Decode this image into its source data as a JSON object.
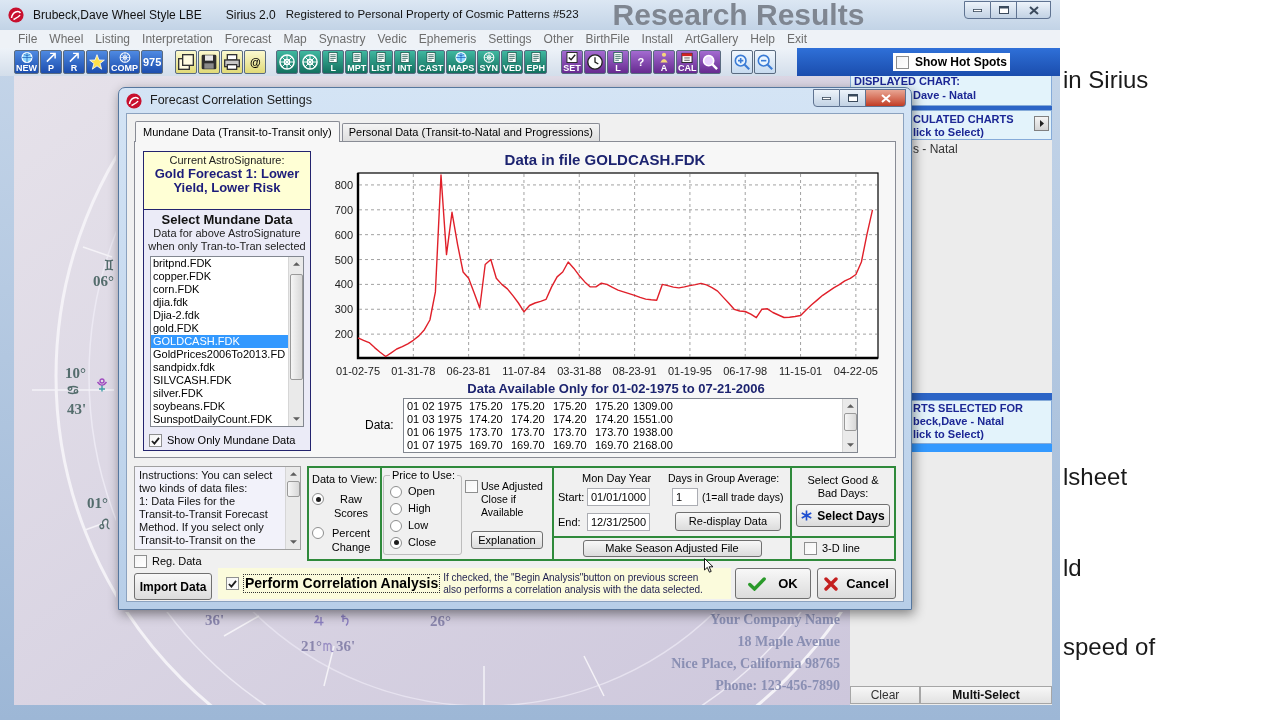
{
  "main_window": {
    "title": "Brubeck,Dave Wheel Style LBE",
    "app_name": "Sirius 2.0",
    "registration": "Registered to Personal Property of Cosmic Patterns #523",
    "backdrop_heading": "Research Results"
  },
  "menu": [
    "File",
    "Wheel",
    "Listing",
    "Interpretation",
    "Forecast",
    "Map",
    "Synastry",
    "Vedic",
    "Ephemeris",
    "Settings",
    "Other",
    "BirthFile",
    "Install",
    "ArtGallery",
    "Help",
    "Exit"
  ],
  "toolbar": [
    {
      "kind": "chart",
      "buttons": [
        {
          "kind": "globe",
          "label": "NEW"
        },
        {
          "kind": "arrow",
          "label": "P"
        },
        {
          "kind": "arrow",
          "label": "R"
        },
        {
          "kind": "star"
        },
        {
          "kind": "wheel",
          "label": "COMP"
        },
        {
          "label": "975"
        }
      ]
    },
    {
      "kind": "file",
      "buttons": [
        {
          "kind": "windows"
        },
        {
          "kind": "disk"
        },
        {
          "kind": "printer"
        },
        {
          "label": "@"
        }
      ]
    },
    {
      "kind": "report",
      "buttons": [
        {
          "kind": "wheel"
        },
        {
          "kind": "wheel"
        },
        {
          "kind": "page",
          "label": "L"
        },
        {
          "kind": "page",
          "label": "MPT"
        },
        {
          "kind": "page",
          "label": "LIST"
        },
        {
          "kind": "page",
          "label": "INT"
        },
        {
          "kind": "page",
          "label": "CAST"
        },
        {
          "kind": "globe",
          "label": "MAPS"
        },
        {
          "kind": "wheel",
          "label": "SYN"
        },
        {
          "kind": "page",
          "label": "VED"
        },
        {
          "kind": "page",
          "label": "EPH"
        }
      ]
    },
    {
      "kind": "tool",
      "buttons": [
        {
          "kind": "check",
          "label": "SET"
        },
        {
          "kind": "clock"
        },
        {
          "kind": "page",
          "label": "L"
        },
        {
          "label": "?"
        },
        {
          "kind": "figure",
          "label": "A"
        },
        {
          "kind": "calendar",
          "label": "CAL"
        },
        {
          "kind": "magnifier"
        }
      ]
    },
    {
      "kind": "zoom",
      "buttons": [
        {
          "kind": "zoomin"
        },
        {
          "kind": "zoomout"
        }
      ]
    }
  ],
  "hot_spots": {
    "label": "Show Hot Spots",
    "checked": false
  },
  "wheel": {
    "labels": [
      "06°",
      "10°",
      "43'",
      "01°",
      "36'",
      "21°",
      "36'",
      "26°"
    ]
  },
  "company": [
    "Your Company Name",
    "18 Maple Avenue",
    "Nice Place, California 98765",
    "Phone: 123-456-7890"
  ],
  "side_panel": {
    "displayed": {
      "heading": "DISPLAYED CHART:",
      "name": "Dave - Natal"
    },
    "calculated": {
      "heading": "CULATED CHARTS",
      "hint": "lick to Select)",
      "items": [
        {
          "label": "s - Natal",
          "selected": false
        }
      ]
    },
    "selected_for": {
      "heading": "RTS SELECTED FOR",
      "name": "beck,Dave - Natal",
      "hint": "lick to Select)",
      "highlighted_row": true
    },
    "buttons": [
      {
        "label": "Clear",
        "active": false
      },
      {
        "label": "Multi-Select",
        "active": true
      }
    ]
  },
  "dialog": {
    "title": "Forecast Correlation Settings",
    "tabs": [
      {
        "label": "Mundane Data (Transit-to-Transit only)",
        "selected": true
      },
      {
        "label": "Personal Data (Transit-to-Natal and Progressions)",
        "selected": false
      }
    ],
    "signature": {
      "caption": "Current AstroSignature:",
      "name": "Gold Forecast 1: Lower Yield, Lower Risk"
    },
    "mundane": {
      "heading": "Select Mundane Data",
      "note": "Data for above AstroSignature when only Tran-to-Tran selected",
      "files": [
        {
          "name": "britpnd.FDK",
          "selected": false
        },
        {
          "name": "copper.FDK",
          "selected": false
        },
        {
          "name": "corn.FDK",
          "selected": false
        },
        {
          "name": "djia.fdk",
          "selected": false
        },
        {
          "name": "Djia-2.fdk",
          "selected": false
        },
        {
          "name": "gold.FDK",
          "selected": false
        },
        {
          "name": "GOLDCASH.FDK",
          "selected": true
        },
        {
          "name": "GoldPrices2006To2013.FD",
          "selected": false
        },
        {
          "name": "sandpidx.fdk",
          "selected": false
        },
        {
          "name": "SILVCASH.FDK",
          "selected": false
        },
        {
          "name": "silver.FDK",
          "selected": false
        },
        {
          "name": "soybeans.FDK",
          "selected": false
        },
        {
          "name": "SunspotDailyCount.FDK",
          "selected": false
        }
      ],
      "show_only": {
        "label": "Show Only Mundane Data",
        "checked": true
      }
    },
    "chart_data": {
      "type": "line",
      "title": "Data in file GOLDCASH.FDK",
      "grid": true,
      "categories": [
        "01-02-75",
        null,
        null,
        null,
        null,
        null,
        null,
        null,
        null,
        null,
        "01-31-78",
        null,
        null,
        null,
        null,
        null,
        null,
        null,
        null,
        null,
        "06-23-81",
        null,
        null,
        null,
        null,
        null,
        null,
        null,
        null,
        null,
        "11-07-84",
        null,
        null,
        null,
        null,
        null,
        null,
        null,
        null,
        null,
        "03-31-88",
        null,
        null,
        null,
        null,
        null,
        null,
        null,
        null,
        null,
        "08-23-91",
        null,
        null,
        null,
        null,
        null,
        null,
        null,
        null,
        null,
        "01-19-95",
        null,
        null,
        null,
        null,
        null,
        null,
        null,
        null,
        null,
        "06-17-98",
        null,
        null,
        null,
        null,
        null,
        null,
        null,
        null,
        null,
        "11-15-01",
        null,
        null,
        null,
        null,
        null,
        null,
        null,
        null,
        null,
        "04-22-05",
        null,
        null,
        null
      ],
      "series": [
        {
          "color": "#e0202a",
          "values": [
            185,
            175,
            166,
            146,
            127,
            110,
            125,
            140,
            150,
            161,
            175,
            193,
            218,
            257,
            370,
            840,
            520,
            690,
            560,
            450,
            425,
            365,
            305,
            480,
            500,
            425,
            400,
            382,
            355,
            325,
            290,
            315,
            325,
            332,
            340,
            390,
            430,
            450,
            490,
            465,
            435,
            410,
            390,
            390,
            405,
            400,
            388,
            377,
            370,
            363,
            356,
            348,
            341,
            338,
            336,
            400,
            395,
            389,
            386,
            390,
            395,
            399,
            404,
            398,
            387,
            373,
            349,
            325,
            300,
            293,
            291,
            280,
            266,
            300,
            302,
            287,
            277,
            267,
            268,
            271,
            275,
            297,
            318,
            337,
            356,
            371,
            386,
            399,
            414,
            424,
            440,
            490,
            600,
            700
          ]
        }
      ],
      "ylim": [
        104,
        848
      ],
      "yticks": [
        200,
        300,
        400,
        500,
        600,
        700,
        800
      ]
    },
    "availability": "Data Available Only for 01-02-1975 to 07-21-2006",
    "data_label": "Data:",
    "data_rows": [
      [
        "01 02 1975",
        "175.20",
        "175.20",
        "175.20",
        "175.20",
        "1309.00"
      ],
      [
        "01 03 1975",
        "174.20",
        "174.20",
        "174.20",
        "174.20",
        "1551.00"
      ],
      [
        "01 06 1975",
        "173.70",
        "173.70",
        "173.70",
        "173.70",
        "1938.00"
      ],
      [
        "01 07 1975",
        "169.70",
        "169.70",
        "169.70",
        "169.70",
        "2168.00"
      ]
    ],
    "instructions": "Instructions: You can select two kinds of data files:\n1: Data Files for the Transit-to-Transit Forecast Method. If you select only Transit-to-Transit on the",
    "reg_data": {
      "label": "Reg. Data",
      "checked": false
    },
    "import_button": "Import Data",
    "view": {
      "title": "Data to View:",
      "options": [
        {
          "label": "Raw Scores",
          "selected": true
        },
        {
          "label": "Percent Change",
          "selected": false
        }
      ]
    },
    "price": {
      "title": "Price to Use:",
      "options": [
        {
          "label": "Open",
          "selected": false
        },
        {
          "label": "High",
          "selected": false
        },
        {
          "label": "Low",
          "selected": false
        },
        {
          "label": "Close",
          "selected": true
        }
      ]
    },
    "adjusted": {
      "label": "Use Adjusted Close if Available",
      "checked": false
    },
    "explanation_button": "Explanation",
    "range": {
      "heading": "Mon Day Year",
      "start_label": "Start:",
      "start": "01/01/1000",
      "end_label": "End:",
      "end": "12/31/2500"
    },
    "grouping": {
      "heading": "Days in Group Average:",
      "value": "1",
      "note": "(1=all trade days)"
    },
    "redisplay_button": "Re-display Data",
    "season_button": "Make Season Adjusted File",
    "good_bad": {
      "heading": "Select Good & Bad Days:",
      "button": "Select Days"
    },
    "three_d": {
      "label": "3-D line",
      "checked": false
    },
    "correlation": {
      "label": "Perform Correlation Analysis",
      "checked": true,
      "note": "If checked, the \"Begin Analysis\"button on previous screen also performs a correlation analysis with the data selected."
    },
    "ok_button": "OK",
    "cancel_button": "Cancel"
  },
  "slide_text": [
    "in Sirius",
    "lsheet",
    "ld",
    "speed of"
  ]
}
